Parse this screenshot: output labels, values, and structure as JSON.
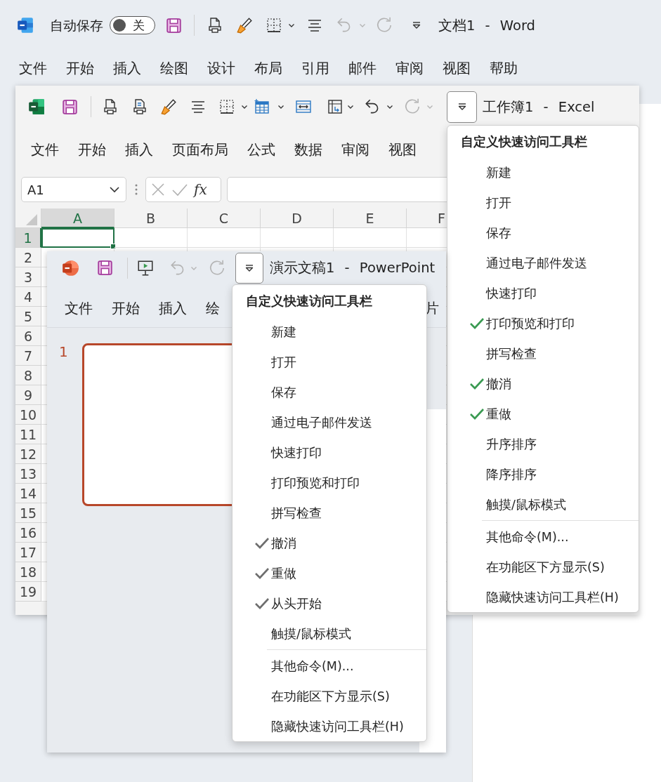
{
  "word": {
    "title": "文档1 - Word",
    "autosave": {
      "label": "自动保存",
      "on": false,
      "state_text": "关"
    },
    "undo": {
      "disabled": true
    },
    "redo": {
      "disabled": true
    },
    "customize_button": {
      "expanded": false
    },
    "tabs": [
      "文件",
      "开始",
      "插入",
      "绘图",
      "设计",
      "布局",
      "引用",
      "邮件",
      "审阅",
      "视图",
      "帮助"
    ]
  },
  "excel": {
    "title": "工作簿1 - Excel",
    "undo": {
      "disabled": false
    },
    "redo": {
      "disabled": true
    },
    "customize_button": {
      "expanded": true
    },
    "tabs": [
      "文件",
      "开始",
      "插入",
      "页面布局",
      "公式",
      "数据",
      "审阅",
      "视图"
    ],
    "name_box": {
      "value": "A1"
    },
    "function_button": "fx",
    "columns": [
      {
        "label": "A",
        "selected": true
      },
      {
        "label": "B",
        "selected": false
      },
      {
        "label": "C",
        "selected": false
      },
      {
        "label": "D",
        "selected": false
      },
      {
        "label": "E",
        "selected": false
      },
      {
        "label": "F",
        "selected": false
      }
    ],
    "rows": [
      {
        "label": "1",
        "selected": true
      },
      {
        "label": "2",
        "selected": false
      },
      {
        "label": "3",
        "selected": false
      },
      {
        "label": "4",
        "selected": false
      },
      {
        "label": "5",
        "selected": false
      },
      {
        "label": "6",
        "selected": false
      },
      {
        "label": "7",
        "selected": false
      },
      {
        "label": "8",
        "selected": false
      },
      {
        "label": "9",
        "selected": false
      },
      {
        "label": "10",
        "selected": false
      },
      {
        "label": "11",
        "selected": false
      },
      {
        "label": "12",
        "selected": false
      },
      {
        "label": "13",
        "selected": false
      },
      {
        "label": "14",
        "selected": false
      },
      {
        "label": "15",
        "selected": false
      },
      {
        "label": "16",
        "selected": false
      },
      {
        "label": "17",
        "selected": false
      },
      {
        "label": "18",
        "selected": false
      },
      {
        "label": "19",
        "selected": false
      }
    ],
    "quick_access_menu": {
      "title": "自定义快速访问工具栏",
      "sections": [
        {
          "items": [
            {
              "label": "新建",
              "checked": false
            },
            {
              "label": "打开",
              "checked": false
            },
            {
              "label": "保存",
              "checked": false
            },
            {
              "label": "通过电子邮件发送",
              "checked": false
            },
            {
              "label": "快速打印",
              "checked": false
            },
            {
              "label": "打印预览和打印",
              "checked": true
            },
            {
              "label": "拼写检查",
              "checked": false
            },
            {
              "label": "撤消",
              "checked": true
            },
            {
              "label": "重做",
              "checked": true
            },
            {
              "label": "升序排序",
              "checked": false
            },
            {
              "label": "降序排序",
              "checked": false
            },
            {
              "label": "触摸/鼠标模式",
              "checked": false
            }
          ]
        },
        {
          "items": [
            {
              "label": "其他命令(M)...",
              "checked": false
            },
            {
              "label": "在功能区下方显示(S)",
              "checked": false
            },
            {
              "label": "隐藏快速访问工具栏(H)",
              "checked": false
            }
          ]
        }
      ]
    }
  },
  "powerpoint": {
    "title": "演示文稿1 - PowerPoint",
    "undo": {
      "disabled": true
    },
    "redo": {
      "disabled": true
    },
    "customize_button": {
      "expanded": true
    },
    "tabs": [
      "文件",
      "开始",
      "插入",
      "绘"
    ],
    "tab_fragment_right": "片",
    "slides": [
      {
        "number": "1",
        "selected": true
      }
    ],
    "quick_access_menu": {
      "title": "自定义快速访问工具栏",
      "sections": [
        {
          "items": [
            {
              "label": "新建",
              "checked": false
            },
            {
              "label": "打开",
              "checked": false
            },
            {
              "label": "保存",
              "checked": false
            },
            {
              "label": "通过电子邮件发送",
              "checked": false
            },
            {
              "label": "快速打印",
              "checked": false
            },
            {
              "label": "打印预览和打印",
              "checked": false
            },
            {
              "label": "拼写检查",
              "checked": false
            },
            {
              "label": "撤消",
              "checked": true
            },
            {
              "label": "重做",
              "checked": true
            },
            {
              "label": "从头开始",
              "checked": true
            },
            {
              "label": "触摸/鼠标模式",
              "checked": false
            }
          ]
        },
        {
          "items": [
            {
              "label": "其他命令(M)...",
              "checked": false
            },
            {
              "label": "在功能区下方显示(S)",
              "checked": false
            },
            {
              "label": "隐藏快速访问工具栏(H)",
              "checked": false
            }
          ]
        }
      ]
    }
  }
}
